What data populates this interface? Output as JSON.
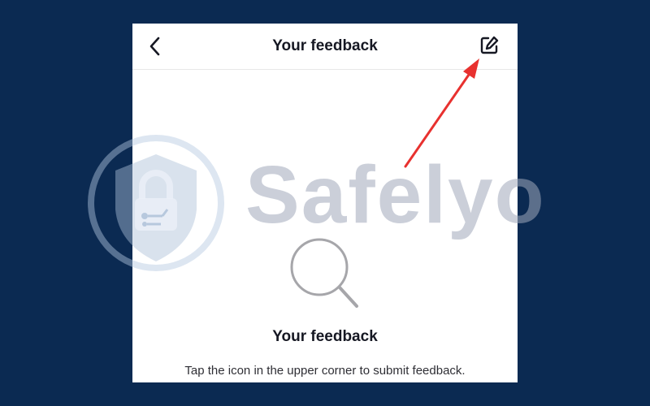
{
  "header": {
    "title": "Your feedback",
    "back_icon": "chevron-left-icon",
    "edit_icon": "edit-icon"
  },
  "empty_state": {
    "icon": "search-icon",
    "title": "Your feedback",
    "subtitle": "Tap the icon in the upper corner to submit feedback."
  },
  "watermark": {
    "text": "Safelyo",
    "logo": "shield-lock-logo"
  },
  "annotation": {
    "arrow_color": "#e8312f"
  },
  "colors": {
    "background": "#0b2a52",
    "panel": "#ffffff",
    "text": "#161823"
  }
}
